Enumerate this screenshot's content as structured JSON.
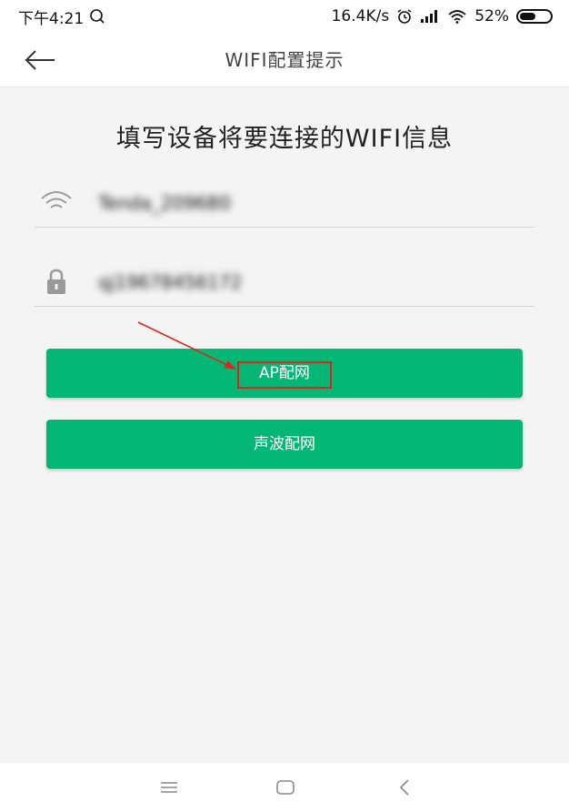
{
  "status_bar": {
    "time": "下午4:21",
    "network_speed": "16.4K/s",
    "battery_percent": "52%",
    "battery_level": 0.52
  },
  "header": {
    "title": "WIFI配置提示"
  },
  "main": {
    "heading": "填写设备将要连接的WIFI信息",
    "wifi_field": {
      "value": "Tenda_2096B0"
    },
    "password_field": {
      "value": "qj19678456172"
    },
    "ap_button_label": "AP配网",
    "sound_button_label": "声波配网"
  },
  "colors": {
    "accent": "#05b775",
    "annotation_red": "#d9271c"
  },
  "icons": [
    "back-arrow-icon",
    "wifi-icon",
    "lock-icon",
    "alarm-clock-icon",
    "signal-icon",
    "menu-icon",
    "home-icon",
    "back-icon"
  ]
}
